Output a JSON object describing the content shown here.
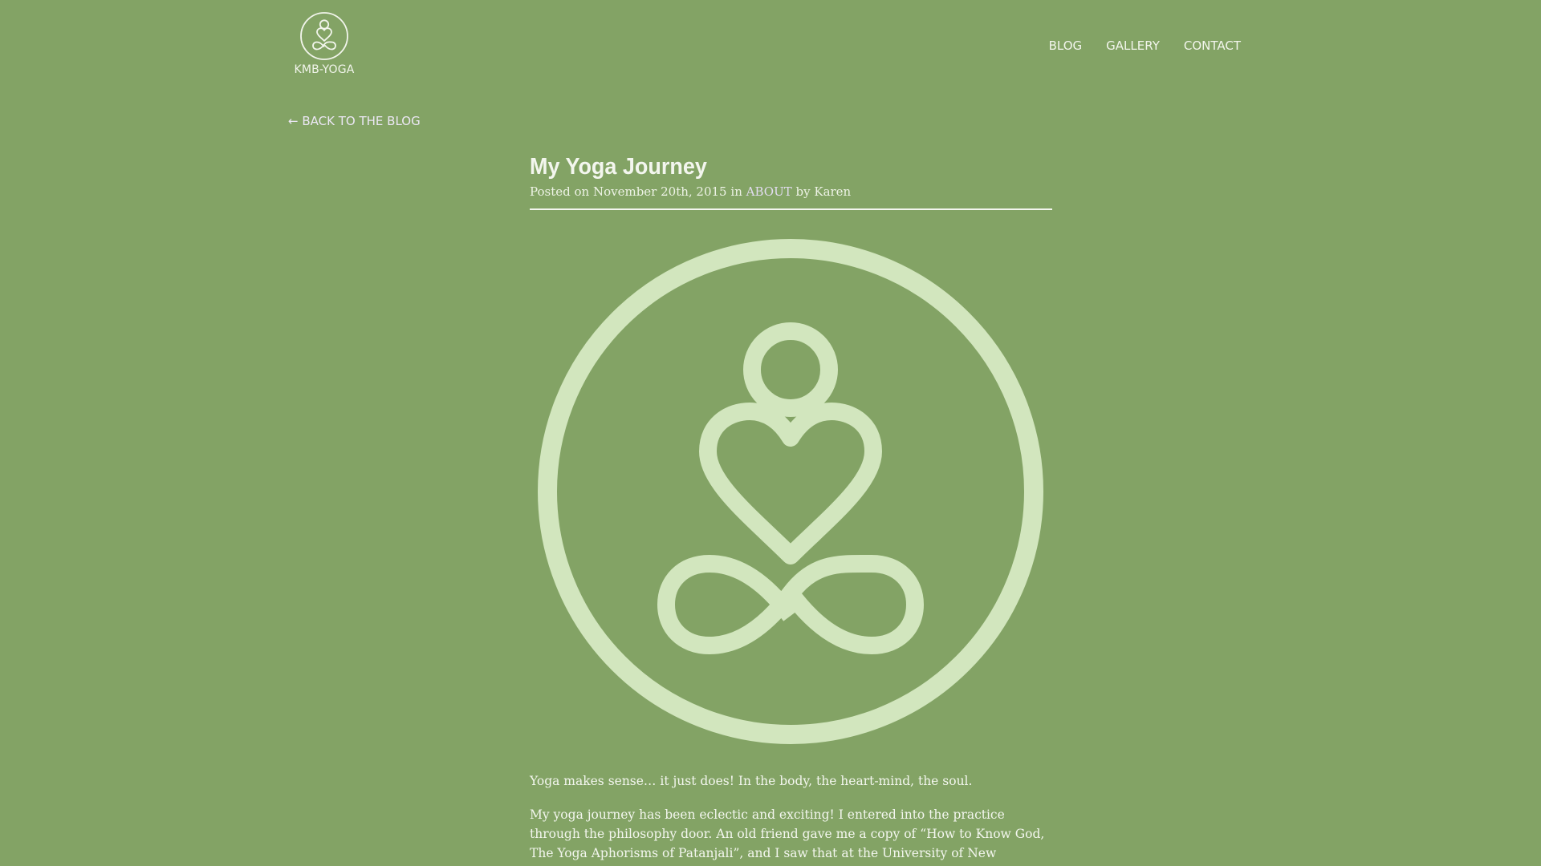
{
  "header": {
    "brand_name": "KMB-YOGA",
    "nav": {
      "blog": "BLOG",
      "gallery": "GALLERY",
      "contact": "CONTACT"
    }
  },
  "back_link": {
    "arrow": "←",
    "label": "BACK TO THE BLOG"
  },
  "post": {
    "title": "My Yoga Journey",
    "meta": {
      "posted_on_prefix": "Posted on",
      "date": "November 20th, 2015",
      "in_word": "in",
      "category": "ABOUT",
      "by_word": "by",
      "author": "Karen"
    },
    "image_icon": "meditation-figure-icon",
    "paragraphs": [
      "Yoga makes sense… it just does! In the body, the heart-mind, the soul.",
      "My yoga journey has been eclectic and exciting! I entered into the practice through the philosophy door. An old friend gave me a copy of “How to Know God, The Yoga Aphorisms of Patanjali”, and I saw that at the University of New"
    ]
  },
  "colors": {
    "background": "#83a365",
    "text": "#f2f5ec",
    "logo_fill": "#d2e6be",
    "link_accent": "#e2dcf0"
  }
}
